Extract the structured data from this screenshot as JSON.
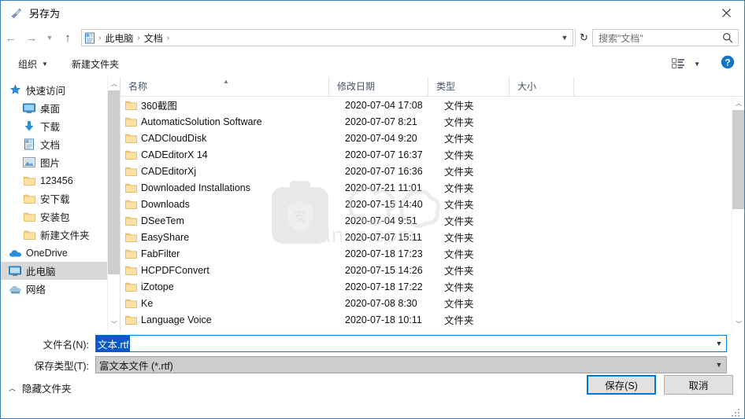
{
  "window": {
    "title": "另存为",
    "title_icon": "paintbrush-icon",
    "close_label": "✕"
  },
  "nav": {
    "back_icon": "back-arrow-icon",
    "forward_icon": "forward-arrow-icon",
    "recent_icon": "chevron-down-icon",
    "up_icon": "up-arrow-icon",
    "refresh_icon": "refresh-icon",
    "breadcrumb_icon": "documents-folder-icon",
    "breadcrumbs": [
      "此电脑",
      "文档"
    ],
    "separator": "›"
  },
  "search": {
    "placeholder": "搜索\"文档\"",
    "icon": "search-icon"
  },
  "command_bar": {
    "organize_label": "组织",
    "new_folder_label": "新建文件夹",
    "view_icon": "view-layout-icon",
    "help_icon": "help-icon"
  },
  "sidebar": {
    "items": [
      {
        "label": "快速访问",
        "icon": "star-pin-icon",
        "level": 0,
        "pinned": false,
        "selected": false
      },
      {
        "label": "桌面",
        "icon": "desktop-icon",
        "level": 1,
        "pinned": true,
        "selected": false
      },
      {
        "label": "下载",
        "icon": "download-icon",
        "level": 1,
        "pinned": true,
        "selected": false
      },
      {
        "label": "文档",
        "icon": "documents-icon",
        "level": 1,
        "pinned": true,
        "selected": false
      },
      {
        "label": "图片",
        "icon": "pictures-icon",
        "level": 1,
        "pinned": true,
        "selected": false
      },
      {
        "label": "123456",
        "icon": "folder-icon",
        "level": 1,
        "pinned": false,
        "selected": false
      },
      {
        "label": "安下载",
        "icon": "folder-icon",
        "level": 1,
        "pinned": false,
        "selected": false
      },
      {
        "label": "安装包",
        "icon": "folder-icon",
        "level": 1,
        "pinned": false,
        "selected": false
      },
      {
        "label": "新建文件夹",
        "icon": "folder-icon",
        "level": 1,
        "pinned": false,
        "selected": false
      },
      {
        "label": "OneDrive",
        "icon": "onedrive-cloud-icon",
        "level": 0,
        "pinned": false,
        "selected": false
      },
      {
        "label": "此电脑",
        "icon": "this-pc-icon",
        "level": 0,
        "pinned": false,
        "selected": true
      },
      {
        "label": "网络",
        "icon": "network-icon",
        "level": 0,
        "pinned": false,
        "selected": false
      }
    ]
  },
  "file_list": {
    "columns": [
      "名称",
      "修改日期",
      "类型",
      "大小"
    ],
    "sort_column": "名称",
    "sort_direction": "asc",
    "rows": [
      {
        "name": "360截图",
        "date": "2020-07-04 17:08",
        "type": "文件夹",
        "size": ""
      },
      {
        "name": "AutomaticSolution Software",
        "date": "2020-07-07 8:21",
        "type": "文件夹",
        "size": ""
      },
      {
        "name": "CADCloudDisk",
        "date": "2020-07-04 9:20",
        "type": "文件夹",
        "size": ""
      },
      {
        "name": "CADEditorX 14",
        "date": "2020-07-07 16:37",
        "type": "文件夹",
        "size": ""
      },
      {
        "name": "CADEditorXj",
        "date": "2020-07-07 16:36",
        "type": "文件夹",
        "size": ""
      },
      {
        "name": "Downloaded Installations",
        "date": "2020-07-21 11:01",
        "type": "文件夹",
        "size": ""
      },
      {
        "name": "Downloads",
        "date": "2020-07-15 14:40",
        "type": "文件夹",
        "size": ""
      },
      {
        "name": "DSeeTem",
        "date": "2020-07-04 9:51",
        "type": "文件夹",
        "size": ""
      },
      {
        "name": "EasyShare",
        "date": "2020-07-07 15:11",
        "type": "文件夹",
        "size": ""
      },
      {
        "name": "FabFilter",
        "date": "2020-07-18 17:23",
        "type": "文件夹",
        "size": ""
      },
      {
        "name": "HCPDFConvert",
        "date": "2020-07-15 14:26",
        "type": "文件夹",
        "size": ""
      },
      {
        "name": "iZotope",
        "date": "2020-07-18 17:22",
        "type": "文件夹",
        "size": ""
      },
      {
        "name": "Ke",
        "date": "2020-07-08 8:30",
        "type": "文件夹",
        "size": ""
      },
      {
        "name": "Language Voice",
        "date": "2020-07-18 10:11",
        "type": "文件夹",
        "size": ""
      }
    ]
  },
  "watermark": {
    "text": "anxz.com",
    "badge_char": "安"
  },
  "footer": {
    "filename_label": "文件名(N):",
    "filename_value": "文本.rtf",
    "filetype_label": "保存类型(T):",
    "filetype_value": "富文本文件 (*.rtf)",
    "hide_folders_label": "隐藏文件夹",
    "save_label": "保存(S)",
    "cancel_label": "取消"
  },
  "colors": {
    "accent": "#0078d7",
    "selection": "#0a58c8",
    "border": "#3a7cb8",
    "folder": "#ffd88a",
    "header_text": "#44546a"
  }
}
